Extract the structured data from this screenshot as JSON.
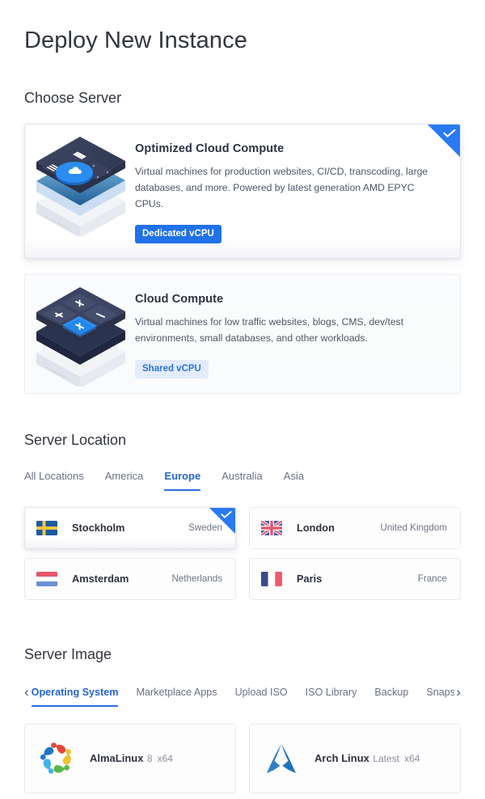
{
  "page": {
    "title": "Deploy New Instance"
  },
  "sections": {
    "server": {
      "title": "Choose Server"
    },
    "location": {
      "title": "Server Location"
    },
    "image": {
      "title": "Server Image"
    }
  },
  "server_types": [
    {
      "name": "Optimized Cloud Compute",
      "description": "Virtual machines for production websites, CI/CD, transcoding, large databases, and more. Powered by latest generation AMD EPYC CPUs.",
      "badge": "Dedicated vCPU",
      "badge_style": "solid",
      "selected": true,
      "art": "server-chip-cloud-illustration"
    },
    {
      "name": "Cloud Compute",
      "description": "Virtual machines for low traffic websites, blogs, CMS, dev/test environments, small databases, and other workloads.",
      "badge": "Shared vCPU",
      "badge_style": "soft",
      "selected": false,
      "art": "server-keys-plus-illustration"
    }
  ],
  "location_tabs": [
    {
      "label": "All Locations",
      "active": false
    },
    {
      "label": "America",
      "active": false
    },
    {
      "label": "Europe",
      "active": true
    },
    {
      "label": "Australia",
      "active": false
    },
    {
      "label": "Asia",
      "active": false
    }
  ],
  "locations": [
    {
      "city": "Stockholm",
      "country": "Sweden",
      "flag": "flag-sweden",
      "selected": true
    },
    {
      "city": "London",
      "country": "United Kingdom",
      "flag": "flag-united-kingdom",
      "selected": false
    },
    {
      "city": "Amsterdam",
      "country": "Netherlands",
      "flag": "flag-netherlands",
      "selected": false
    },
    {
      "city": "Paris",
      "country": "France",
      "flag": "flag-france",
      "selected": false
    }
  ],
  "image_tabs": [
    {
      "label": "Operating System",
      "active": true
    },
    {
      "label": "Marketplace Apps",
      "active": false
    },
    {
      "label": "Upload ISO",
      "active": false
    },
    {
      "label": "ISO Library",
      "active": false
    },
    {
      "label": "Backup",
      "active": false
    },
    {
      "label": "Snapshot",
      "active": false
    }
  ],
  "image_tabs_nav": {
    "prev": "‹",
    "next": "›"
  },
  "os_images": [
    {
      "name": "AlmaLinux",
      "version": "8",
      "arch": "x64",
      "logo": "almalinux-logo"
    },
    {
      "name": "Arch Linux",
      "version": "Latest",
      "arch": "x64",
      "logo": "archlinux-logo"
    }
  ],
  "colors": {
    "accent_blue": "#2979f5",
    "tab_active": "#2564d8",
    "badge_solid_bg": "#2071e8",
    "badge_soft_bg": "#e2ecfd",
    "heading": "#31353f"
  }
}
